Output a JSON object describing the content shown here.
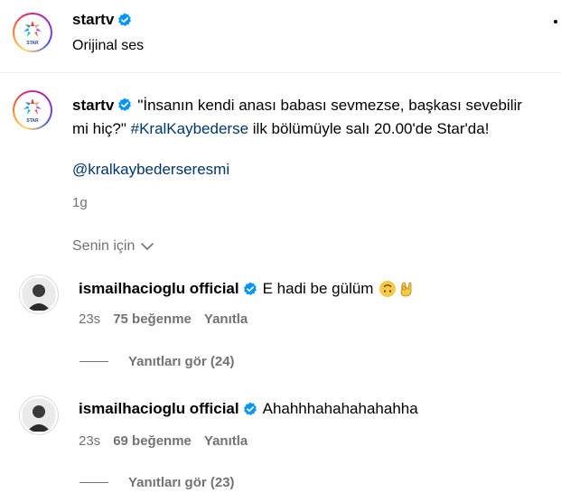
{
  "header": {
    "username": "startv",
    "subtitle": "Orijinal ses"
  },
  "post": {
    "username": "startv",
    "caption_quote": "\"İnsanın kendi anası babası sevmezse, başkası sevebilir mi hiç?\"",
    "hashtag": "#KralKaybederse",
    "caption_rest": "ilk bölümüyle salı 20.00'de Star'da!",
    "mention": "@kralkaybederseresmi",
    "time": "1g",
    "logo_text": "STAR"
  },
  "filter": {
    "label": "Senin için"
  },
  "comments": [
    {
      "username": "ismailhacioglu official",
      "text": "E hadi be gülüm",
      "time": "23s",
      "likes": "75 beğenme",
      "reply": "Yanıtla",
      "view_replies": "Yanıtları gör (24)"
    },
    {
      "username": "ismailhacioglu official",
      "text": "Ahahhhahahahahahha",
      "time": "23s",
      "likes": "69 beğenme",
      "reply": "Yanıtla",
      "view_replies": "Yanıtları gör (23)"
    }
  ],
  "colors": {
    "verified": "#0095f6",
    "link": "#00376b",
    "muted": "#737373"
  },
  "icons": {
    "verified": "verified-badge-icon",
    "chevron": "chevron-down-icon",
    "more": "more-options-icon"
  }
}
